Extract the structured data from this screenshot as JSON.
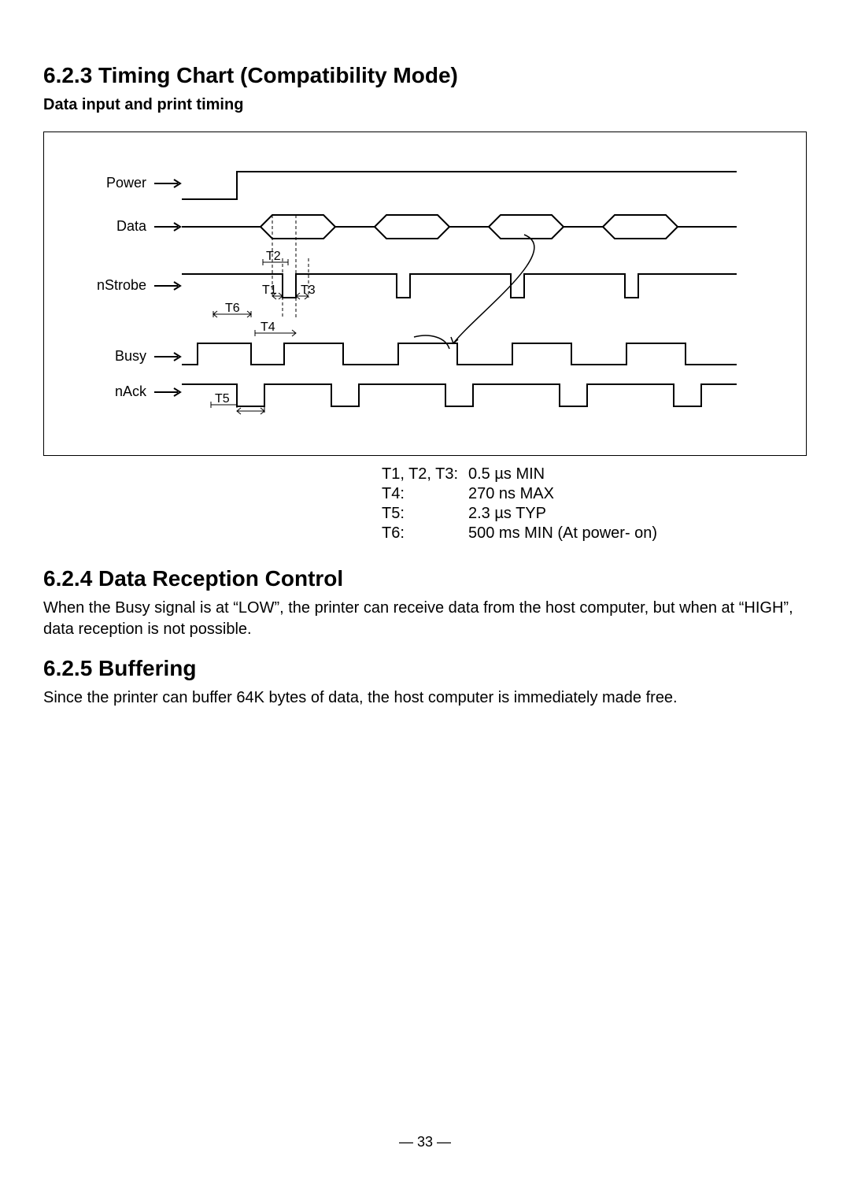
{
  "section_623": {
    "heading": "6.2.3 Timing Chart (Compatibility Mode)",
    "subtitle": "Data input and print timing",
    "signals": {
      "power": "Power",
      "data": "Data",
      "nstrobe": "nStrobe",
      "busy": "Busy",
      "nack": "nAck"
    },
    "markers": {
      "t1": "T1",
      "t2": "T2",
      "t3": "T3",
      "t4": "T4",
      "t5": "T5",
      "t6": "T6"
    },
    "legend": [
      {
        "key": "T1, T2, T3:",
        "val": "0.5 µs MIN"
      },
      {
        "key": "T4:",
        "val": "270 ns MAX"
      },
      {
        "key": "T5:",
        "val": "2.3 µs TYP"
      },
      {
        "key": "T6:",
        "val": "500 ms MIN (At power- on)"
      }
    ]
  },
  "section_624": {
    "heading": "6.2.4 Data Reception Control",
    "text": "When the Busy signal is at “LOW”, the printer can receive data from the host computer, but when at “HIGH”, data reception is not possible."
  },
  "section_625": {
    "heading": "6.2.5 Buffering",
    "text": "Since the printer can buffer 64K bytes of data, the host computer is immediately made free."
  },
  "page_number": "— 33 —"
}
